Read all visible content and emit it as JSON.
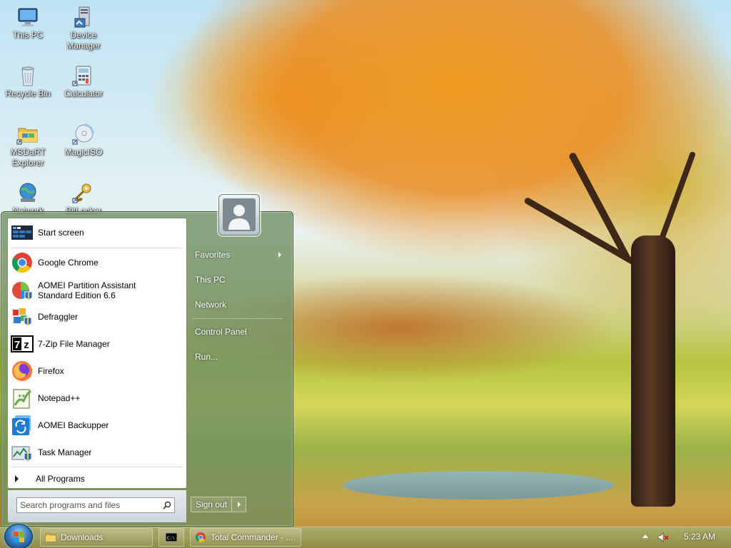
{
  "desktop": {
    "icons": [
      {
        "label": "This PC",
        "icon": "computer-icon"
      },
      {
        "label": "Device Manager",
        "icon": "device-manager-icon"
      },
      {
        "label": "Recycle Bin",
        "icon": "recycle-bin-icon"
      },
      {
        "label": "Calculator",
        "icon": "calculator-icon"
      },
      {
        "label": "MSDaRT Explorer",
        "icon": "folder-icon"
      },
      {
        "label": "MagicISO",
        "icon": "disc-icon"
      },
      {
        "label": "Network",
        "icon": "network-icon"
      },
      {
        "label": "BitLocker",
        "icon": "key-icon"
      }
    ]
  },
  "start_menu": {
    "programs": [
      {
        "label": "Start screen",
        "icon": "start-screen-icon"
      },
      {
        "label": "Google Chrome",
        "icon": "chrome-icon"
      },
      {
        "label": "AOMEI Partition Assistant Standard Edition 6.6",
        "icon": "aomei-partition-icon"
      },
      {
        "label": "Defraggler",
        "icon": "defraggler-icon"
      },
      {
        "label": "7-Zip File Manager",
        "icon": "7zip-icon"
      },
      {
        "label": "Firefox",
        "icon": "firefox-icon"
      },
      {
        "label": "Notepad++",
        "icon": "notepad-plus-plus-icon"
      },
      {
        "label": "AOMEI Backupper",
        "icon": "aomei-backupper-icon"
      },
      {
        "label": "Task Manager",
        "icon": "task-manager-icon"
      }
    ],
    "all_programs": "All Programs",
    "search_placeholder": "Search programs and files",
    "right_items": {
      "favorites": "Favorites",
      "this_pc": "This PC",
      "network": "Network",
      "control_panel": "Control Panel",
      "run": "Run..."
    },
    "sign_out": "Sign out"
  },
  "taskbar": {
    "buttons": [
      {
        "label": "Downloads",
        "icon": "folder-icon"
      },
      {
        "label": "",
        "icon": "cmd-icon"
      },
      {
        "label": "Total Commander - ...",
        "icon": "chrome-icon"
      }
    ],
    "clock": "5:23 AM"
  }
}
